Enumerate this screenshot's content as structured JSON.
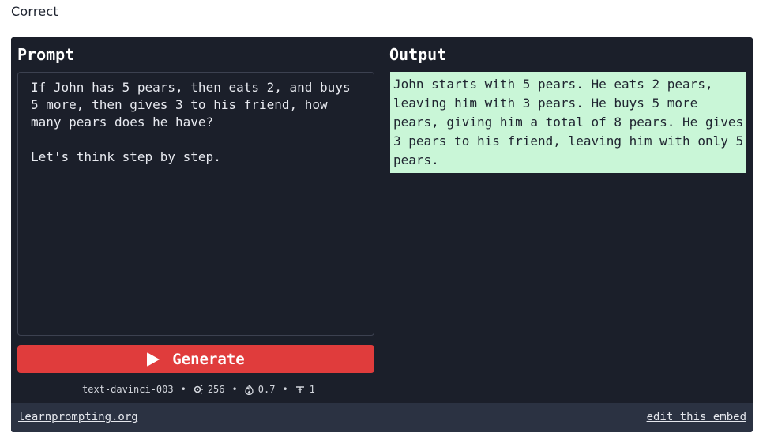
{
  "status": {
    "text": "Correct"
  },
  "prompt": {
    "title": "Prompt",
    "text": "If John has 5 pears, then eats 2, and buys\n5 more, then gives 3 to his friend, how\nmany pears does he have?\n\nLet's think step by step."
  },
  "output": {
    "title": "Output",
    "text": "John starts with 5 pears. He eats 2 pears,\nleaving him with 3 pears. He buys 5 more\npears, giving him a total of 8 pears. He gives\n3 pears to his friend, leaving him with only 5\npears."
  },
  "generate": {
    "label": "Generate"
  },
  "meta": {
    "model": "text-davinci-003",
    "max_tokens": "256",
    "temperature": "0.7",
    "top_p": "1"
  },
  "footer": {
    "left_link": "learnprompting.org",
    "right_link": "edit this embed"
  },
  "colors": {
    "panel_bg": "#1b1f2a",
    "footer_bg": "#2b3242",
    "output_bg": "#c9f6d7",
    "button_bg": "#e03c3c"
  }
}
